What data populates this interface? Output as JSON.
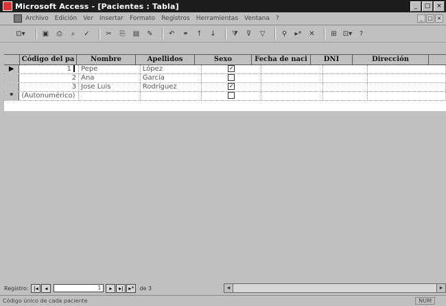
{
  "window": {
    "title": "Microsoft Access - [Pacientes : Tabla]",
    "controls": [
      "_",
      "□",
      "×"
    ]
  },
  "menu": {
    "items": [
      "Archivo",
      "Edición",
      "Ver",
      "Insertar",
      "Formato",
      "Registros",
      "Herramientas",
      "Ventana",
      "?"
    ],
    "doc_controls": [
      "_",
      "□",
      "×"
    ]
  },
  "table": {
    "columns": [
      "Código del pa",
      "Nombre",
      "Apellidos",
      "Sexo",
      "Fecha de naci",
      "DNI",
      "Dirección"
    ],
    "rows": [
      {
        "selector": "▶",
        "codigo": "1",
        "nombre": "Pepe",
        "apellidos": "López",
        "sexo": true
      },
      {
        "selector": "",
        "codigo": "2",
        "nombre": "Ana",
        "apellidos": "García",
        "sexo": false
      },
      {
        "selector": "",
        "codigo": "3",
        "nombre": "Jose Luis",
        "apellidos": "Rodríguez",
        "sexo": true
      }
    ],
    "new_row": {
      "selector": "*",
      "codigo": "(Autonumérico)"
    }
  },
  "navigation": {
    "label": "Registro:",
    "current": "1",
    "of_label": "de 3"
  },
  "status": {
    "left": "Código único de cada paciente",
    "right": "NUM"
  }
}
